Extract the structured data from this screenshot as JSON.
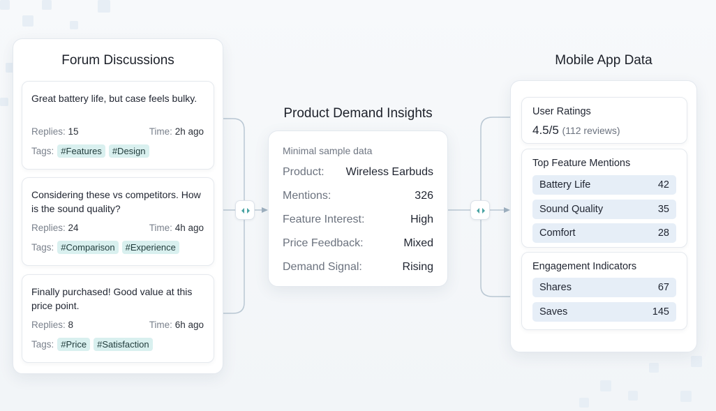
{
  "forum": {
    "title": "Forum Discussions",
    "posts": [
      {
        "text": "Great battery life, but case feels bulky.",
        "replies_label": "Replies:",
        "replies": "15",
        "time_label": "Time:",
        "time": "2h ago",
        "tags_label": "Tags:",
        "tags": [
          "#Features",
          "#Design"
        ]
      },
      {
        "text": "Considering these vs competitors. How is the sound quality?",
        "replies_label": "Replies:",
        "replies": "24",
        "time_label": "Time:",
        "time": "4h ago",
        "tags_label": "Tags:",
        "tags": [
          "#Comparison",
          "#Experience"
        ]
      },
      {
        "text": "Finally purchased! Good value at this price point.",
        "replies_label": "Replies:",
        "replies": "8",
        "time_label": "Time:",
        "time": "6h ago",
        "tags_label": "Tags:",
        "tags": [
          "#Price",
          "#Satisfaction"
        ]
      }
    ]
  },
  "insights": {
    "title": "Product Demand Insights",
    "note": "Minimal sample data",
    "rows": [
      {
        "key": "Product:",
        "value": "Wireless Earbuds"
      },
      {
        "key": "Mentions:",
        "value": "326"
      },
      {
        "key": "Feature Interest:",
        "value": "High"
      },
      {
        "key": "Price Feedback:",
        "value": "Mixed"
      },
      {
        "key": "Demand Signal:",
        "value": "Rising"
      }
    ]
  },
  "mobile": {
    "title": "Mobile App Data",
    "ratings": {
      "heading": "User Ratings",
      "score": "4.5/5",
      "reviews": "(112 reviews)"
    },
    "features": {
      "heading": "Top Feature Mentions",
      "items": [
        {
          "label": "Battery Life",
          "value": "42"
        },
        {
          "label": "Sound Quality",
          "value": "35"
        },
        {
          "label": "Comfort",
          "value": "28"
        }
      ]
    },
    "engagement": {
      "heading": "Engagement Indicators",
      "items": [
        {
          "label": "Shares",
          "value": "67"
        },
        {
          "label": "Saves",
          "value": "145"
        }
      ]
    }
  },
  "colors": {
    "tag_bg": "#d9f0ef",
    "pill_bg": "#e6eef7",
    "connector": "#b9c7d3",
    "chevron": "#4aa3a3"
  }
}
